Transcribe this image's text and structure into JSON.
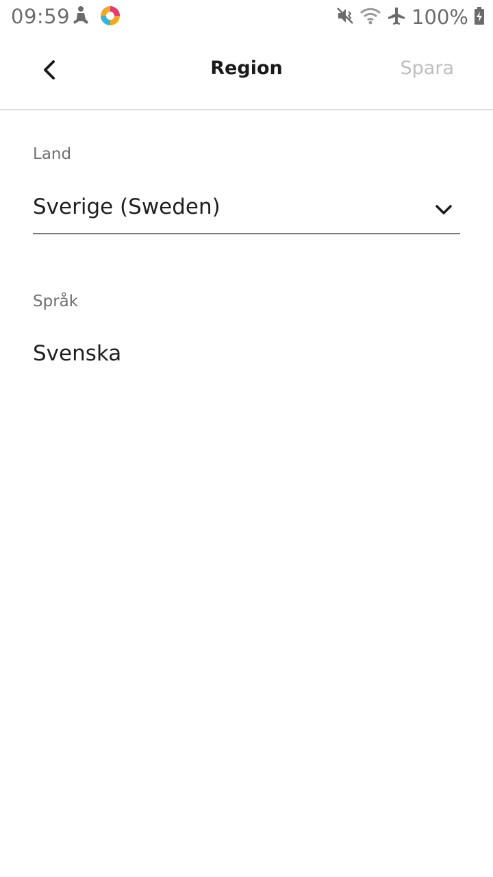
{
  "status_bar": {
    "time": "09:59",
    "battery_text": "100%",
    "icons": [
      "yoga-app-icon",
      "colorful-app-icon",
      "vibrate-icon",
      "wifi-icon",
      "airplane-icon",
      "battery-charging-icon"
    ]
  },
  "app_bar": {
    "title": "Region",
    "save_label": "Spara",
    "save_color": "#bdbdbd"
  },
  "form": {
    "country_label": "Land",
    "country_value": "Sverige (Sweden)",
    "language_label": "Språk",
    "language_value": "Svenska"
  }
}
